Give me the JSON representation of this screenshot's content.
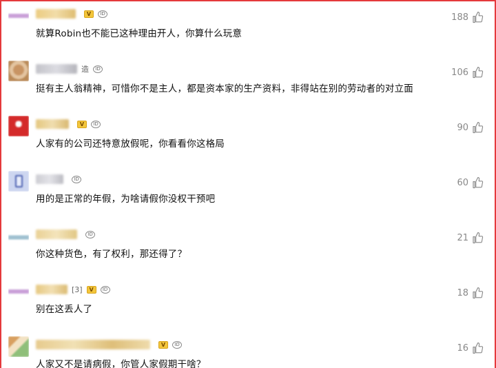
{
  "icons": {
    "like": "thumbs-up-icon",
    "vip": "vip-badge-icon",
    "id": "id-badge-icon"
  },
  "colors": {
    "border": "#e4393c",
    "text": "#111111",
    "like": "#888888"
  },
  "comments": [
    {
      "name_suffix": "",
      "text": "就算Robin也不能已这种理由开人，你算什么玩意",
      "likes": "188",
      "vip": true
    },
    {
      "name_suffix": "造",
      "text": "挺有主人翁精神，可惜你不是主人，都是资本家的生产资料，非得站在别的劳动者的对立面",
      "likes": "106",
      "vip": false
    },
    {
      "name_suffix": "",
      "text": "人家有的公司还特意放假呢，你看看你这格局",
      "likes": "90",
      "vip": true
    },
    {
      "name_suffix": "",
      "text": "用的是正常的年假，为啥请假你没权干预吧",
      "likes": "60",
      "vip": false
    },
    {
      "name_suffix": "",
      "text": "你这种货色，有了权利，那还得了？",
      "likes": "21",
      "vip": false
    },
    {
      "name_suffix": "[3]",
      "text": "别在这丢人了",
      "likes": "18",
      "vip": true
    },
    {
      "name_suffix": "",
      "text": "人家又不是请病假，你管人家假期干啥？",
      "likes": "16",
      "vip": true
    }
  ]
}
